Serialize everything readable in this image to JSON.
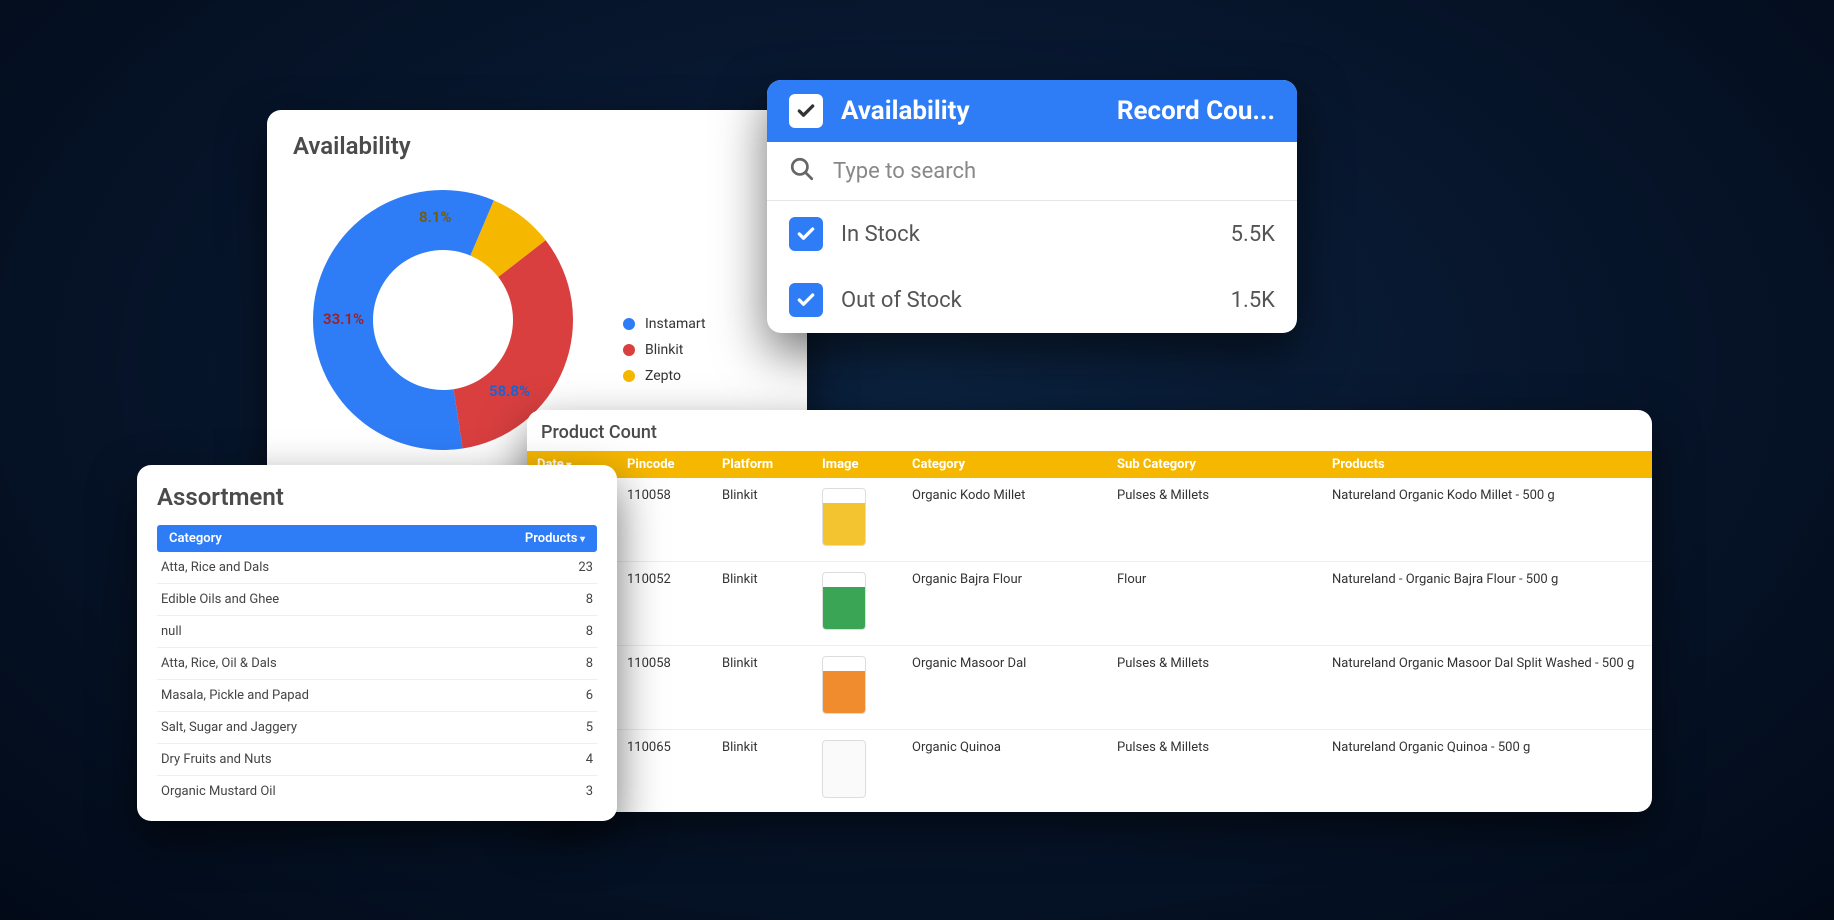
{
  "availability_card": {
    "title": "Availability",
    "legend": [
      {
        "label": "Instamart",
        "color": "#2e7cf6",
        "pct": "58.8%"
      },
      {
        "label": "Blinkit",
        "color": "#d93f3f",
        "pct": "33.1%"
      },
      {
        "label": "Zepto",
        "color": "#f6b700",
        "pct": "8.1%"
      }
    ]
  },
  "chart_data": {
    "type": "pie",
    "title": "Availability",
    "series": [
      {
        "name": "Instamart",
        "value": 58.8,
        "color": "#2e7cf6"
      },
      {
        "name": "Blinkit",
        "value": 33.1,
        "color": "#d93f3f"
      },
      {
        "name": "Zepto",
        "value": 8.1,
        "color": "#f6b700"
      }
    ]
  },
  "filter_card": {
    "col_a": "Availability",
    "col_b": "Record Cou...",
    "search_placeholder": "Type to search",
    "rows": [
      {
        "label": "In Stock",
        "count": "5.5K"
      },
      {
        "label": "Out of Stock",
        "count": "1.5K"
      }
    ]
  },
  "assortment_card": {
    "title": "Assortment",
    "head_category": "Category",
    "head_products": "Products",
    "rows": [
      {
        "category": "Atta, Rice and Dals",
        "products": "23"
      },
      {
        "category": "Edible Oils and Ghee",
        "products": "8"
      },
      {
        "category": "null",
        "products": "8"
      },
      {
        "category": "Atta, Rice, Oil & Dals",
        "products": "8"
      },
      {
        "category": "Masala, Pickle and Papad",
        "products": "6"
      },
      {
        "category": "Salt, Sugar and Jaggery",
        "products": "5"
      },
      {
        "category": "Dry Fruits and Nuts",
        "products": "4"
      },
      {
        "category": "Organic Mustard Oil",
        "products": "3"
      }
    ]
  },
  "product_card": {
    "title": "Product Count",
    "head": {
      "date": "Date",
      "pincode": "Pincode",
      "platform": "Platform",
      "image": "Image",
      "category": "Category",
      "sub": "Sub Category",
      "products": "Products"
    },
    "rows": [
      {
        "pincode": "110058",
        "platform": "Blinkit",
        "img": "yellow",
        "category": "Organic Kodo Millet",
        "sub": "Pulses & Millets",
        "product": "Natureland Organic Kodo Millet - 500 g"
      },
      {
        "pincode": "110052",
        "platform": "Blinkit",
        "img": "green",
        "category": "Organic Bajra Flour",
        "sub": "Flour",
        "product": "Natureland - Organic Bajra Flour - 500 g"
      },
      {
        "pincode": "110058",
        "platform": "Blinkit",
        "img": "orange",
        "category": "Organic Masoor Dal",
        "sub": "Pulses & Millets",
        "product": "Natureland Organic Masoor Dal Split Washed - 500 g"
      },
      {
        "pincode": "110065",
        "platform": "Blinkit",
        "img": "white",
        "category": "Organic Quinoa",
        "sub": "Pulses & Millets",
        "product": "Natureland Organic Quinoa - 500 g"
      }
    ]
  }
}
